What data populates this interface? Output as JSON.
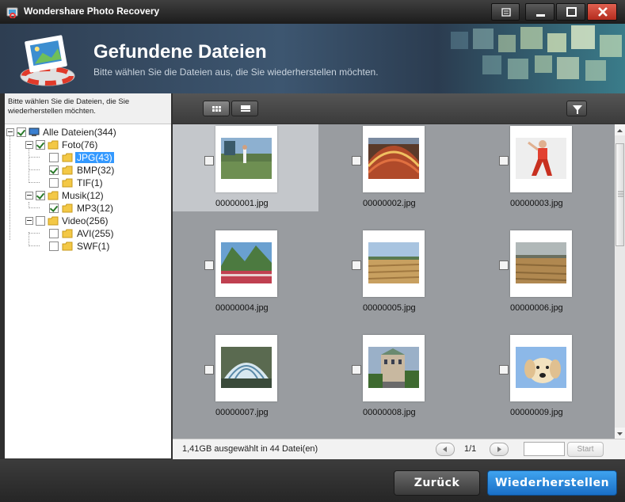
{
  "window": {
    "title": "Wondershare Photo Recovery"
  },
  "header": {
    "title": "Gefundene Dateien",
    "subtitle": "Bitte wählen Sie die Dateien aus, die Sie wiederherstellen möchten."
  },
  "left_panel": {
    "instruction": "Bitte wählen Sie die Dateien, die Sie wiederherstellen möchten.",
    "tree": {
      "root": {
        "label": "Alle Dateien(344)",
        "checked": true
      },
      "foto": {
        "label": "Foto(76)",
        "checked": true
      },
      "jpg": {
        "label": "JPG(43)",
        "checked": false,
        "selected": true
      },
      "bmp": {
        "label": "BMP(32)",
        "checked": true
      },
      "tif": {
        "label": "TIF(1)",
        "checked": false
      },
      "musik": {
        "label": "Musik(12)",
        "checked": true
      },
      "mp3": {
        "label": "MP3(12)",
        "checked": true
      },
      "video": {
        "label": "Video(256)",
        "checked": false
      },
      "avi": {
        "label": "AVI(255)",
        "checked": false
      },
      "swf": {
        "label": "SWF(1)",
        "checked": false
      }
    }
  },
  "toolbar": {
    "view_grid_icon": "grid-view-icon",
    "view_list_icon": "list-view-icon",
    "filter_icon": "filter-icon"
  },
  "files": [
    {
      "name": "00000001.jpg",
      "checked": false
    },
    {
      "name": "00000002.jpg",
      "checked": false
    },
    {
      "name": "00000003.jpg",
      "checked": false
    },
    {
      "name": "00000004.jpg",
      "checked": false
    },
    {
      "name": "00000005.jpg",
      "checked": false
    },
    {
      "name": "00000006.jpg",
      "checked": false
    },
    {
      "name": "00000007.jpg",
      "checked": false
    },
    {
      "name": "00000008.jpg",
      "checked": false
    },
    {
      "name": "00000009.jpg",
      "checked": false
    }
  ],
  "status": {
    "selection": "1,41GB ausgewählt in 44 Datei(en)",
    "page": "1/1",
    "page_input": "",
    "start_label": "Start"
  },
  "buttons": {
    "back": "Zurück",
    "recover": "Wiederherstellen"
  },
  "colors": {
    "accent": "#2a86d8",
    "selection": "#3399ff"
  }
}
